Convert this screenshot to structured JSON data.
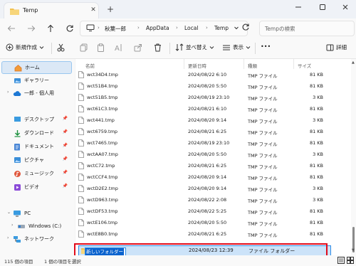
{
  "window": {
    "tab_title": "Temp",
    "new_tab": "+",
    "close_tab": "✕"
  },
  "address": {
    "crumbs": [
      "秋葉一郎",
      "AppData",
      "Local",
      "Temp"
    ],
    "search_placeholder": "Tempの検索"
  },
  "toolbar": {
    "new": "新規作成",
    "sort": "並べ替え",
    "view": "表示",
    "more": "•••",
    "details": "詳細"
  },
  "sidebar": {
    "home": "ホーム",
    "gallery": "ギャラリー",
    "onedrive": "一郎 - 個人用",
    "desktop": "デスクトップ",
    "downloads": "ダウンロード",
    "documents": "ドキュメント",
    "pictures": "ピクチャ",
    "music": "ミュージック",
    "videos": "ビデオ",
    "pc": "PC",
    "windows": "Windows (C:)",
    "network": "ネットワーク"
  },
  "columns": {
    "name": "名前",
    "date": "更新日時",
    "type": "種類",
    "size": "サイズ"
  },
  "files": [
    {
      "name": "wct34D4.tmp",
      "date": "2024/08/22 6:10",
      "type": "TMP ファイル",
      "size": "81 KB"
    },
    {
      "name": "wct51B4.tmp",
      "date": "2024/08/20 5:50",
      "type": "TMP ファイル",
      "size": "81 KB"
    },
    {
      "name": "wct51B5.tmp",
      "date": "2024/08/19 23:10",
      "type": "TMP ファイル",
      "size": "3 KB"
    },
    {
      "name": "wct61C3.tmp",
      "date": "2024/08/21 6:10",
      "type": "TMP ファイル",
      "size": "81 KB"
    },
    {
      "name": "wct441.tmp",
      "date": "2024/08/20 9:14",
      "type": "TMP ファイル",
      "size": "3 KB"
    },
    {
      "name": "wct6759.tmp",
      "date": "2024/08/21 6:25",
      "type": "TMP ファイル",
      "size": "81 KB"
    },
    {
      "name": "wct7465.tmp",
      "date": "2024/08/19 23:10",
      "type": "TMP ファイル",
      "size": "81 KB"
    },
    {
      "name": "wctAA07.tmp",
      "date": "2024/08/20 5:50",
      "type": "TMP ファイル",
      "size": "3 KB"
    },
    {
      "name": "wctC72.tmp",
      "date": "2024/08/21 6:25",
      "type": "TMP ファイル",
      "size": "81 KB"
    },
    {
      "name": "wctCCF4.tmp",
      "date": "2024/08/20 9:14",
      "type": "TMP ファイル",
      "size": "81 KB"
    },
    {
      "name": "wctD2E2.tmp",
      "date": "2024/08/20 9:14",
      "type": "TMP ファイル",
      "size": "3 KB"
    },
    {
      "name": "wctD963.tmp",
      "date": "2024/08/22 2:08",
      "type": "TMP ファイル",
      "size": "3 KB"
    },
    {
      "name": "wctDF53.tmp",
      "date": "2024/08/22 5:25",
      "type": "TMP ファイル",
      "size": "81 KB"
    },
    {
      "name": "wctE106.tmp",
      "date": "2024/08/20 5:50",
      "type": "TMP ファイル",
      "size": "81 KB"
    },
    {
      "name": "wctE8B0.tmp",
      "date": "2024/08/21 6:25",
      "type": "TMP ファイル",
      "size": "81 KB"
    }
  ],
  "new_folder": {
    "name": "新しいフォルダー",
    "date": "2024/08/23 12:39",
    "type": "ファイル フォルダー"
  },
  "status": {
    "count": "115 個の項目",
    "selected": "1 個の項目を選択"
  },
  "colors": {
    "accent": "#0b63ce",
    "highlight": "#e10a1a",
    "folder": "#f2c14e"
  }
}
